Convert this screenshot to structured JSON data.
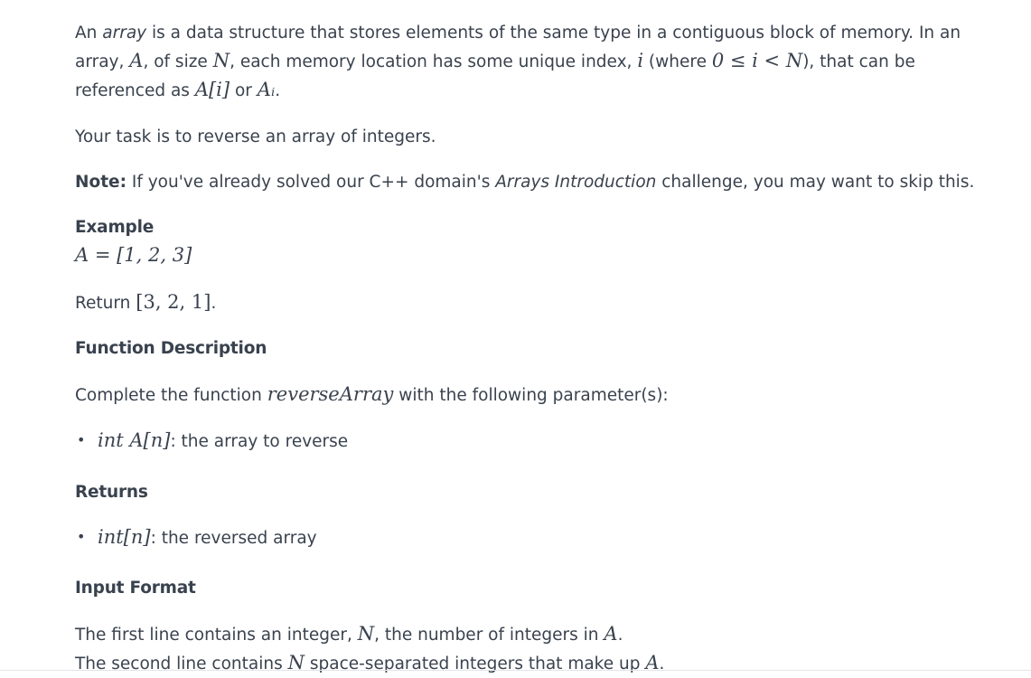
{
  "intro": {
    "t1": "An ",
    "array_italic": "array",
    "t2": " is a data structure that stores elements of the same type in a contiguous block of memory. In an array, ",
    "m_A": "A",
    "t3": ", of size ",
    "m_N": "N",
    "t4": ", each memory location has some unique index, ",
    "m_i": "i",
    "t5": " (where ",
    "m_cond": "0 ≤ i < N",
    "t6": "), that can be referenced as ",
    "m_Ai": "A[i]",
    "t7": " or ",
    "m_Asub": "Aᵢ",
    "t8": "."
  },
  "task": "Your task is to reverse an array of integers.",
  "note": {
    "label": "Note:",
    "t1": " If you've already solved our C++ domain's ",
    "italic": "Arrays Introduction",
    "t2": " challenge, you may want to skip this."
  },
  "example": {
    "heading": "Example",
    "formula": "A = [1, 2, 3]",
    "return_label": "Return ",
    "return_value": "[3, 2, 1]",
    "return_end": "."
  },
  "function_description": {
    "heading": "Function Description",
    "t1": "Complete the function ",
    "func_name": "reverseArray",
    "t2": " with the following parameter(s):",
    "params": [
      {
        "bullet": "•",
        "math": "int A[n]",
        "text": ": the array to reverse"
      }
    ]
  },
  "returns": {
    "heading": "Returns",
    "items": [
      {
        "bullet": "•",
        "math": "int[n]",
        "text": ": the reversed array"
      }
    ]
  },
  "input_format": {
    "heading": "Input Format",
    "line1_t1": "The first line contains an integer, ",
    "line1_m": "N",
    "line1_t2": ", the number of integers in ",
    "line1_m2": "A",
    "line1_t3": ".",
    "line2_t1": "The second line contains ",
    "line2_m": "N",
    "line2_t2": " space-separated integers that make up ",
    "line2_m2": "A",
    "line2_t3": "."
  }
}
